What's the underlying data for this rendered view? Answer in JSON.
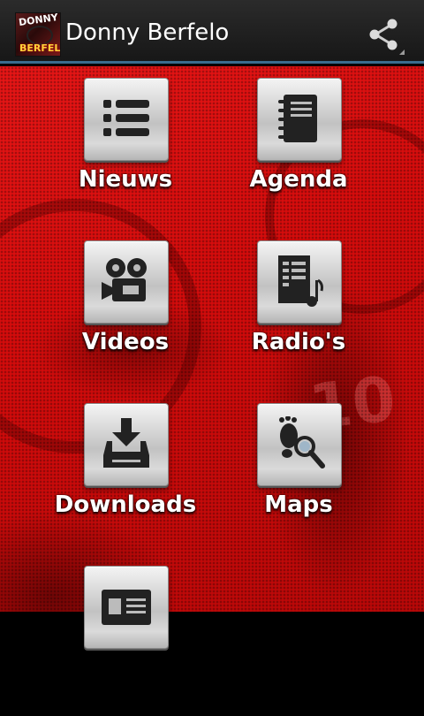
{
  "app": {
    "title": "Donny Berfelo",
    "logo_text_top": "DONNY",
    "logo_text_bottom": "BERFELO"
  },
  "actionbar": {
    "share_icon": "share-icon"
  },
  "menu": [
    {
      "label": "Nieuws",
      "icon": "list-icon"
    },
    {
      "label": "Agenda",
      "icon": "notebook-icon"
    },
    {
      "label": "Videos",
      "icon": "camera-icon"
    },
    {
      "label": "Radio's",
      "icon": "music-file-icon"
    },
    {
      "label": "Downloads",
      "icon": "download-icon"
    },
    {
      "label": "Maps",
      "icon": "footprint-search-icon"
    },
    {
      "label": "",
      "icon": "contact-card-icon"
    }
  ],
  "colors": {
    "background_red": "#d40c0c",
    "actionbar": "#1f1f1f",
    "actionbar_divider": "#3a6c8e",
    "label": "#ffffff"
  }
}
